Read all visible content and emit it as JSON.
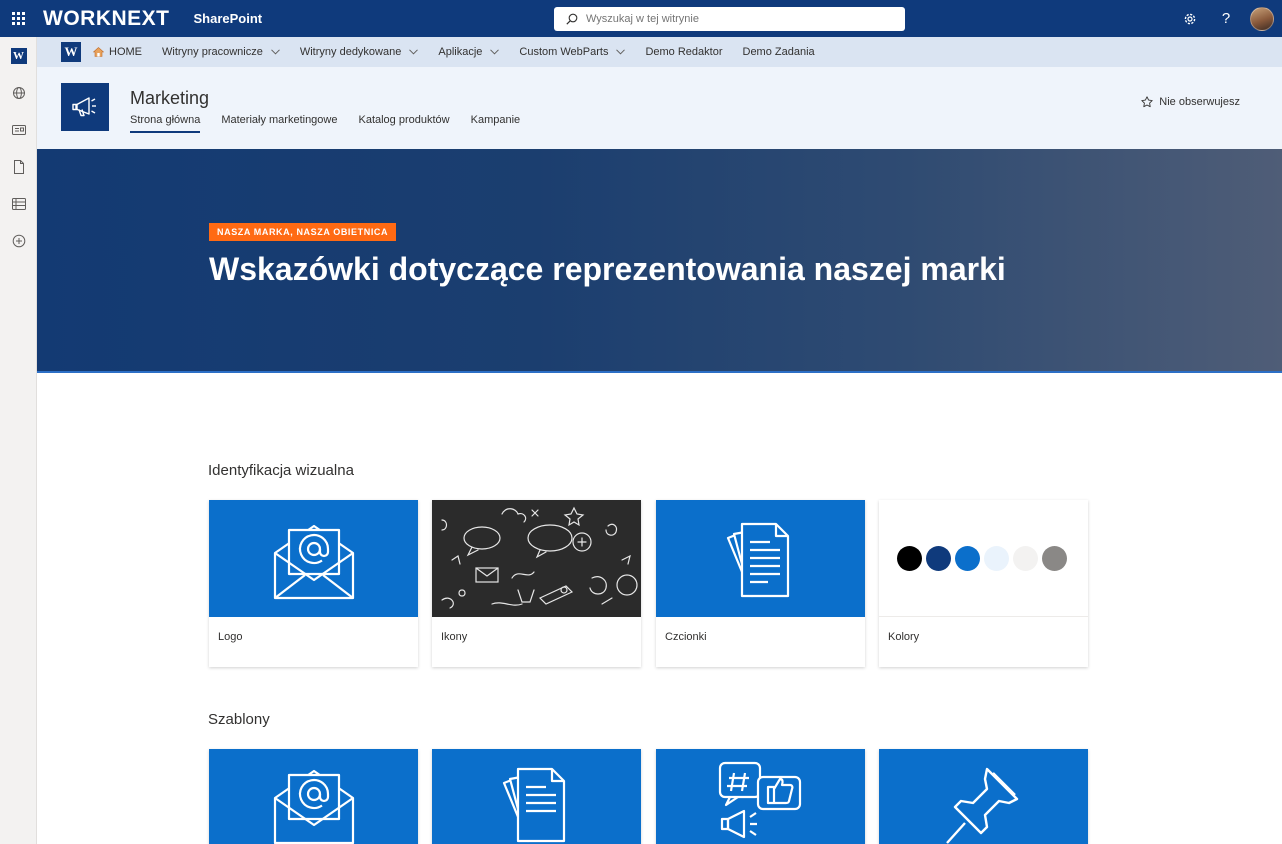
{
  "suite": {
    "brand": "WORKNEXT",
    "app_name": "SharePoint",
    "search_placeholder": "Wyszukaj w tej witrynie",
    "icons": [
      "waffle-icon",
      "settings-icon",
      "help-icon",
      "avatar"
    ],
    "help_glyph": "?"
  },
  "appbar": {
    "logo_letter": "W",
    "items": [
      "w-logo",
      "globe-icon",
      "news-icon",
      "document-icon",
      "list-icon",
      "add-icon"
    ]
  },
  "hubnav": {
    "logo_letter": "W",
    "items": [
      {
        "label": "HOME",
        "icon": "home-icon",
        "dropdown": false
      },
      {
        "label": "Witryny pracownicze",
        "dropdown": true
      },
      {
        "label": "Witryny dedykowane",
        "dropdown": true
      },
      {
        "label": "Aplikacje",
        "dropdown": true
      },
      {
        "label": "Custom WebParts",
        "dropdown": true
      },
      {
        "label": "Demo Redaktor",
        "dropdown": false
      },
      {
        "label": "Demo Zadania",
        "dropdown": false
      }
    ]
  },
  "site": {
    "title": "Marketing",
    "logo_icon": "megaphone-icon",
    "nav": [
      {
        "label": "Strona główna",
        "active": true
      },
      {
        "label": "Materiały marketingowe",
        "active": false
      },
      {
        "label": "Katalog produktów",
        "active": false
      },
      {
        "label": "Kampanie",
        "active": false
      }
    ],
    "follow_label": "Nie obserwujesz"
  },
  "hero": {
    "tag": "NASZA MARKA, NASZA OBIETNICA",
    "title": "Wskazówki dotyczące reprezentowania naszej marki",
    "tag_color": "#ff6a13"
  },
  "sections": [
    {
      "title": "Identyfikacja wizualna",
      "cards": [
        {
          "label": "Logo",
          "icon": "envelope-at-icon"
        },
        {
          "label": "Ikony",
          "icon": "doodle-pattern-image"
        },
        {
          "label": "Czcionki",
          "icon": "documents-icon"
        },
        {
          "label": "Kolory",
          "icon": "color-swatches"
        }
      ]
    },
    {
      "title": "Szablony",
      "cards": [
        {
          "icon": "envelope-at-icon"
        },
        {
          "icon": "documents-icon"
        },
        {
          "icon": "social-media-icon"
        },
        {
          "icon": "pushpin-icon"
        }
      ]
    }
  ],
  "colors": {
    "brand_blue": "#0f3a7c",
    "card_blue": "#0b6fcb",
    "swatches": [
      "#000000",
      "#0f3a7c",
      "#0b6fcb",
      "#eaf3fc",
      "#f3f2f1",
      "#8a8886"
    ]
  }
}
